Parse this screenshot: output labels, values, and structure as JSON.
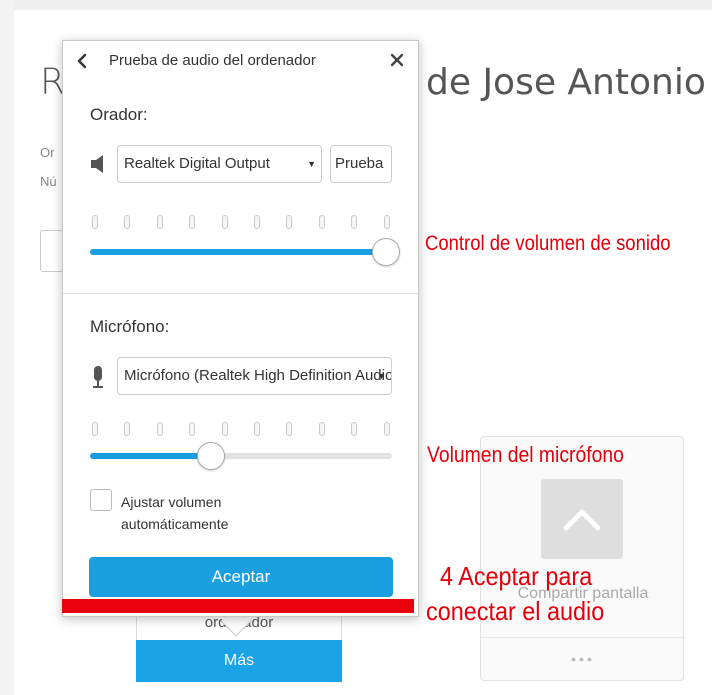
{
  "background": {
    "title_left": "R",
    "title_right": "de Jose Antonio",
    "info_line_1": "Or",
    "info_line_2": "Nú",
    "share_card": {
      "label": "Compartir pantalla",
      "dots": "•••",
      "icon": "chevron-up-icon"
    },
    "audio_card_label": "ordenador",
    "more_button": "Más"
  },
  "popup": {
    "title": "Prueba de audio del ordenador",
    "back_icon": "chevron-left-icon",
    "close_icon": "close-icon",
    "speaker": {
      "label": "Orador:",
      "icon": "speaker-icon",
      "device": "Realtek Digital Output",
      "test_button": "Prueba",
      "volume_fraction": 0.98
    },
    "microphone": {
      "label": "Micrófono:",
      "icon": "microphone-icon",
      "device": "Micrófono (Realtek High Definition Audio)",
      "volume_fraction": 0.4
    },
    "auto_adjust": {
      "checked": false,
      "label": "Ajustar volumen automáticamente"
    },
    "accept_button": "Aceptar"
  },
  "annotations": {
    "speaker_volume": "Control de volumen de sonido",
    "mic_volume": "Volumen del micrófono",
    "accept_line_1": "4 Aceptar para",
    "accept_line_2": "conectar el audio"
  },
  "colors": {
    "accent_blue": "#1a9fe0",
    "annotation_red": "#e3000b"
  }
}
